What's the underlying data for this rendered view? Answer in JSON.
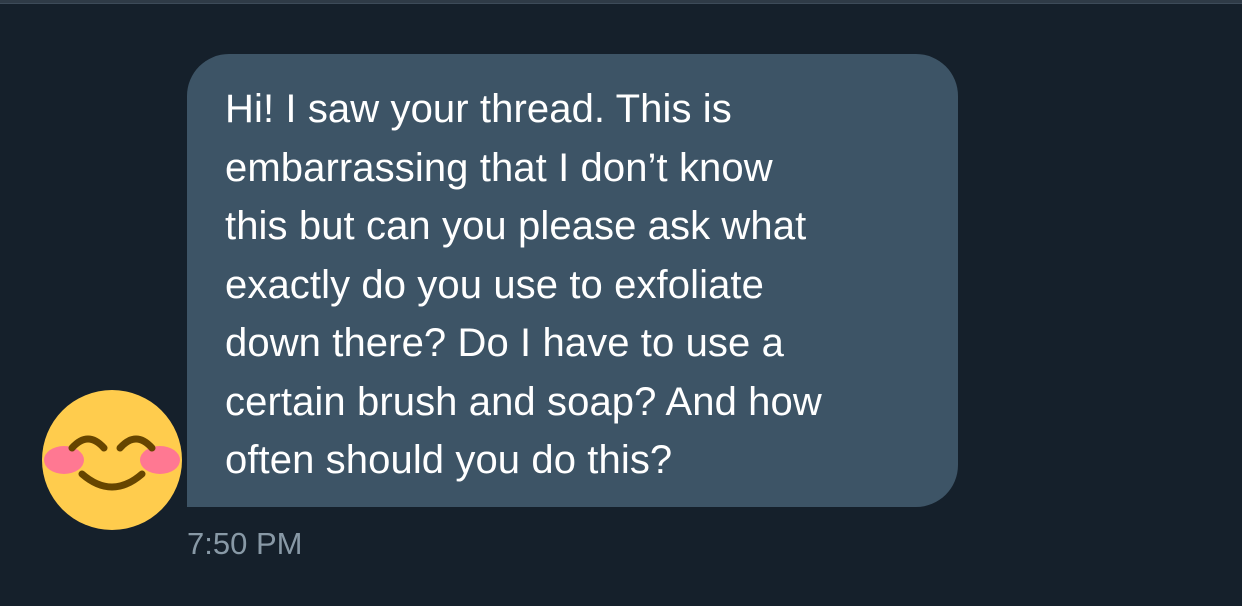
{
  "conversation": {
    "messages": [
      {
        "sender_avatar_icon": "smiling-face-with-smiling-eyes-emoji",
        "text": "Hi! I saw your thread. This is\nembarrassing that I don’t know\nthis but can you please ask what\nexactly do you use to exfoliate\ndown there? Do I have to use a\ncertain brush and soap? And how\noften should you do this?",
        "timestamp": "7:50 PM"
      }
    ]
  },
  "colors": {
    "background": "#15202b",
    "bubble": "#3d5466",
    "message_text": "#ffffff",
    "timestamp": "#8899a6",
    "emoji_face": "#ffcc4d",
    "emoji_blush": "#ff7892",
    "emoji_features": "#664500"
  }
}
